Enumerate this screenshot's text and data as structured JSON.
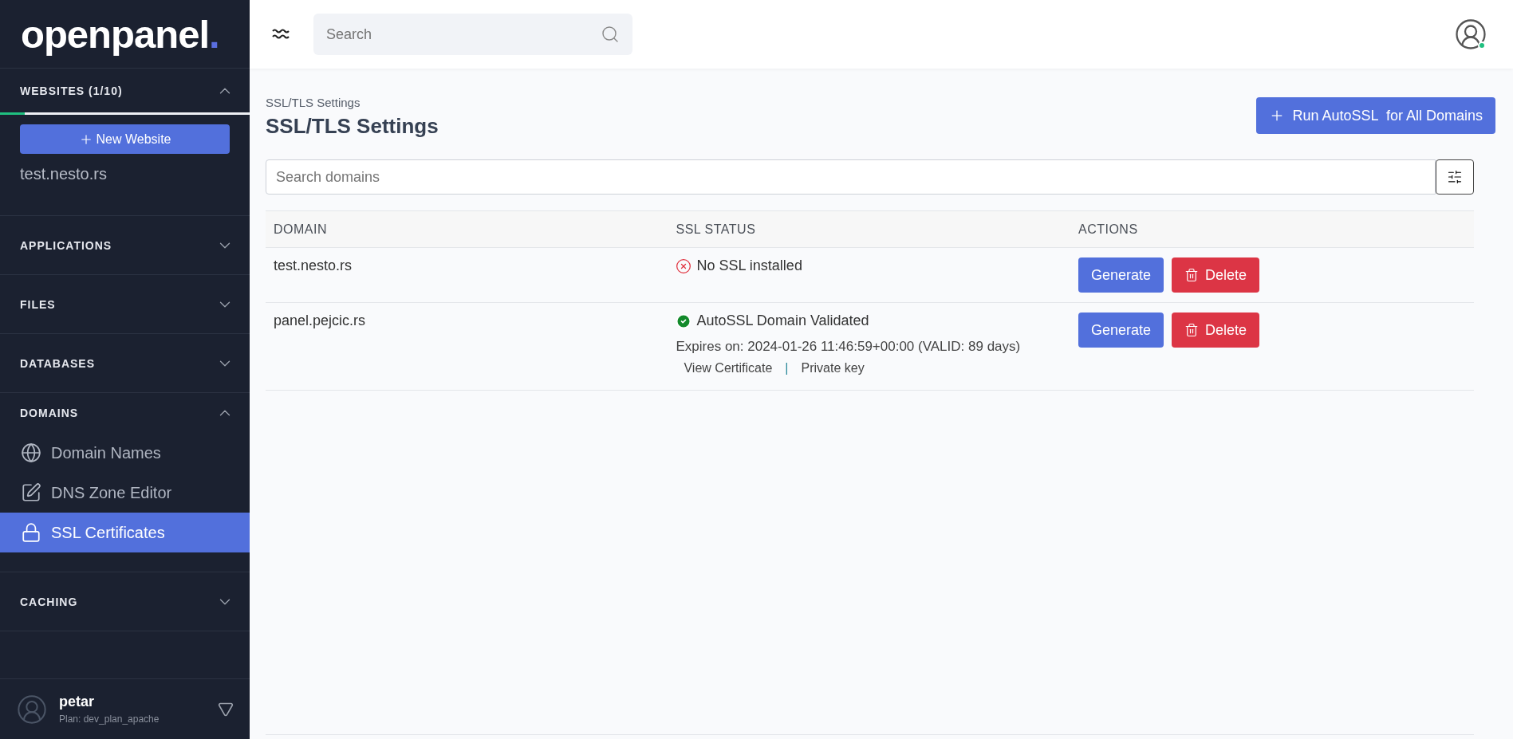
{
  "sidebar": {
    "logo": {
      "name": "openpanel",
      "mark": "."
    },
    "sections": [
      {
        "title": "WEBSITES (1/10)",
        "expanded": true,
        "kind": "websites",
        "level": 0.1,
        "button": "New Website",
        "items": [
          {
            "label": "test.nesto.rs"
          }
        ]
      },
      {
        "title": "APPLICATIONS",
        "expanded": false,
        "kind": "links"
      },
      {
        "title": "FILES",
        "expanded": false,
        "kind": "links"
      },
      {
        "title": "DATABASES",
        "expanded": false,
        "kind": "links"
      },
      {
        "title": "DOMAINS",
        "expanded": true,
        "kind": "links",
        "items": [
          {
            "label": "Domain Names",
            "selected": false
          },
          {
            "label": "DNS Zone Editor",
            "selected": false
          },
          {
            "label": "SSL Certificates",
            "selected": true
          }
        ]
      },
      {
        "title": "CACHING",
        "expanded": false,
        "kind": "links"
      }
    ],
    "user": {
      "name": "petar",
      "plan": "Plan: dev_plan_apache"
    }
  },
  "header": {
    "search_placeholder": "Search",
    "online": true
  },
  "page": {
    "breadcrumb": "SSL/TLS Settings",
    "title": "SSL/TLS Settings",
    "run_button": "Run AutoSSL  for All Domains",
    "search_placeholder": "Search domains",
    "table": {
      "columns": [
        "DOMAIN",
        "SSL STATUS",
        "ACTIONS"
      ],
      "rows": [
        {
          "domain": "test.nesto.rs",
          "status": {
            "kind": "error",
            "text": "No SSL installed"
          },
          "actions": [
            "Generate",
            "Delete"
          ]
        },
        {
          "domain": "panel.pejcic.rs",
          "status": {
            "kind": "valid",
            "text": "AutoSSL Domain Validated"
          },
          "expires": "Expires on: 2024-01-26 11:46:59+00:00 (VALID: 89 days)",
          "links": [
            "View Certificate",
            "Private key"
          ],
          "separator": "|",
          "actions": [
            "Generate",
            "Delete"
          ]
        }
      ]
    }
  }
}
